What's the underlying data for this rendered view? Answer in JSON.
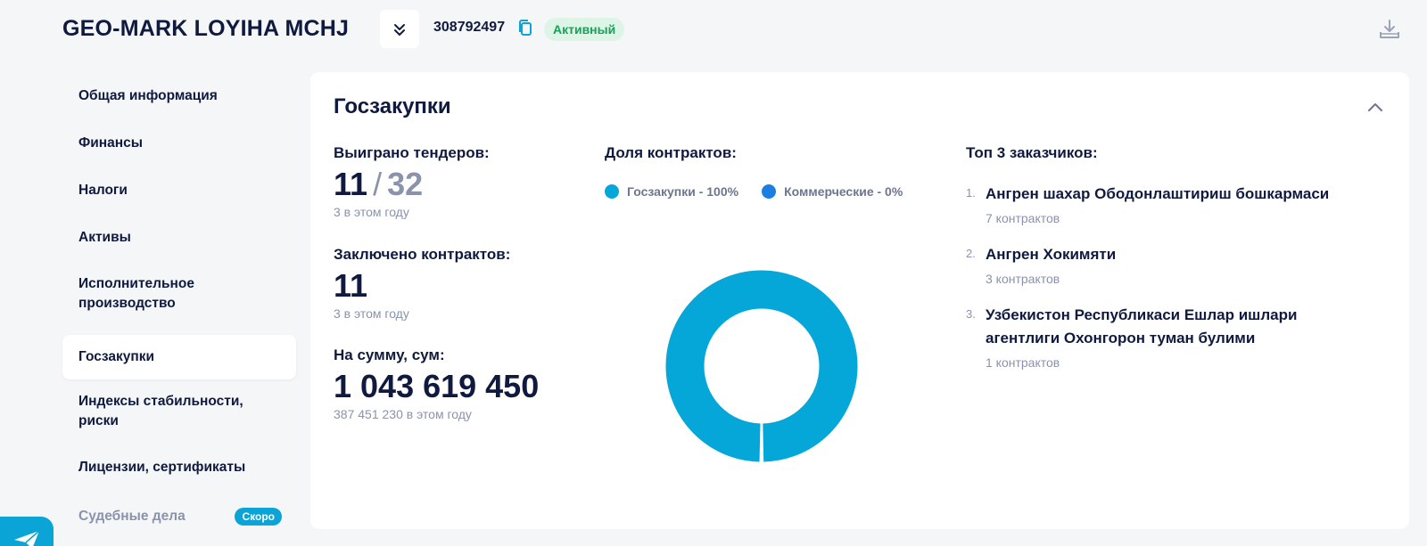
{
  "header": {
    "company_name": "GEO-MARK LOYIHA MCHJ",
    "inn": "308792497",
    "status": "Активный"
  },
  "sidebar": {
    "items": [
      {
        "label": "Общая информация"
      },
      {
        "label": "Финансы"
      },
      {
        "label": "Налоги"
      },
      {
        "label": "Активы"
      },
      {
        "label": "Исполнительное производство"
      },
      {
        "label": "Госзакупки",
        "active": true
      },
      {
        "label": "Индексы стабильности, риски"
      },
      {
        "label": "Лицензии, сертификаты"
      },
      {
        "label": "Судебные дела",
        "badge": "Скоро",
        "disabled": true
      }
    ]
  },
  "card": {
    "title": "Госзакупки",
    "tenders": {
      "label": "Выиграно тендеров:",
      "won": "11",
      "slash": "/",
      "total": "32",
      "sub": "3 в этом году"
    },
    "contracts": {
      "label": "Заключено контрактов:",
      "value": "11",
      "sub": "3 в этом году"
    },
    "amount": {
      "label": "На сумму, сум:",
      "value": "1 043 619 450",
      "sub": "387 451 230 в этом году"
    },
    "share": {
      "title": "Доля контрактов:",
      "legend": [
        {
          "label": "Госзакупки - 100%",
          "color": "#05a6d8"
        },
        {
          "label": "Коммерческие - 0%",
          "color": "#1a7fe0"
        }
      ]
    },
    "top_customers": {
      "title": "Топ 3 заказчиков:",
      "items": [
        {
          "num": "1.",
          "name": "Ангрен шахар Ободонлаштириш бошкармаси",
          "sub": "7 контрактов"
        },
        {
          "num": "2.",
          "name": "Ангрен Хокимяти",
          "sub": "3 контрактов"
        },
        {
          "num": "3.",
          "name": "Узбекистон Республикаси Ешлар ишлари агентлиги Охонгорон туман булими",
          "sub": "1 контрактов"
        }
      ]
    }
  },
  "chart_data": {
    "type": "pie",
    "categories": [
      "Госзакупки",
      "Коммерческие"
    ],
    "values": [
      100,
      0
    ],
    "colors": [
      "#05a6d8",
      "#1a7fe0"
    ]
  }
}
